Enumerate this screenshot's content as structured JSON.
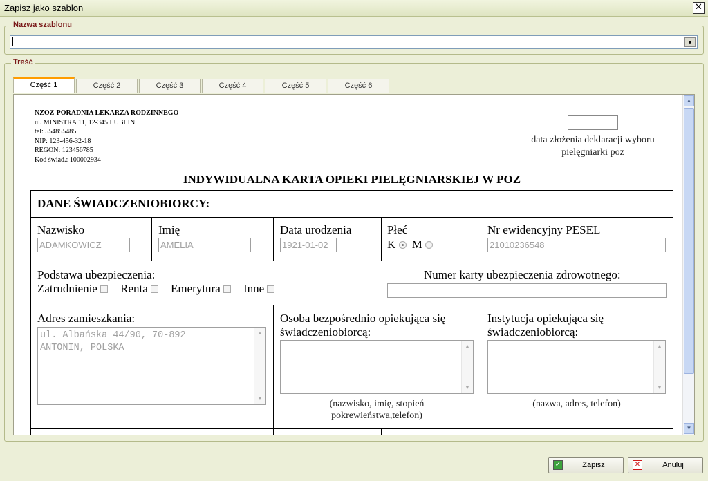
{
  "window": {
    "title": "Zapisz jako szablon"
  },
  "template_name": {
    "legend": "Nazwa szablonu",
    "value": ""
  },
  "content": {
    "legend": "Treść",
    "tabs": [
      "Część 1",
      "Część 2",
      "Część 3",
      "Część 4",
      "Część 5",
      "Część 6"
    ],
    "active_tab": 0
  },
  "document": {
    "clinic": {
      "name": "NZOZ-PORADNIA LEKARZA RODZINNEGO -",
      "address": "ul. MINISTRA 11, 12-345 LUBLIN",
      "tel": "tel: 554855485",
      "nip": "NIP: 123-456-32-18",
      "regon": "REGON: 123456785",
      "kod": "Kod świad.: 100002934"
    },
    "declaration_date_label_1": "data złożenia deklaracji wyboru",
    "declaration_date_label_2": "pielęgniarki poz",
    "title": "INDYWIDUALNA KARTA OPIEKI PIELĘGNIARSKIEJ W POZ",
    "section_header": "DANE ŚWIADCZENIOBIORCY:",
    "fields": {
      "surname_label": "Nazwisko",
      "surname_value": "ADAMKOWICZ",
      "firstname_label": "Imię",
      "firstname_value": "AMELIA",
      "dob_label": "Data urodzenia",
      "dob_value": "1921-01-02",
      "sex_label": "Płeć",
      "sex_k": "K",
      "sex_m": "M",
      "pesel_label": "Nr ewidencyjny PESEL",
      "pesel_value": "21010236548"
    },
    "insurance": {
      "label": "Podstawa ubezpieczenia:",
      "options": [
        "Zatrudnienie",
        "Renta",
        "Emerytura",
        "Inne"
      ],
      "card_label": "Numer karty ubezpieczenia zdrowotnego:"
    },
    "address": {
      "label": "Adres zamieszkania:",
      "line1": "ul. Albańska 44/90, 70-892",
      "line2": "ANTONIN, POLSKA"
    },
    "caregiver": {
      "label_1": "Osoba bezpośrednio opiekująca się",
      "label_2": "świadczeniobiorcą:",
      "note_1": "(nazwisko, imię, stopień",
      "note_2": "pokrewieństwa,telefon)"
    },
    "institution": {
      "label_1": "Instytucja opiekująca się",
      "label_2": "świadczeniobiorcą:",
      "note": "(nazwa, adres, telefon)"
    }
  },
  "buttons": {
    "save": "Zapisz",
    "cancel": "Anuluj"
  },
  "colors": {
    "accent_tab": "#ff9c00",
    "legend": "#7a1a1a",
    "background": "#ecefd8"
  }
}
